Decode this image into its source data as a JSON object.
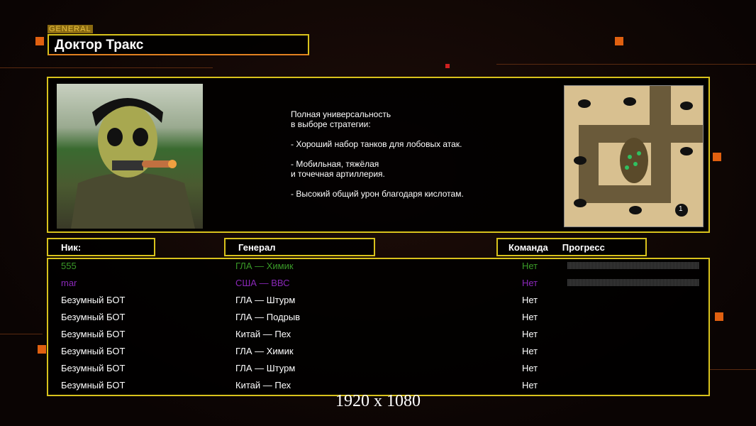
{
  "general_tag": "GENERAL",
  "general_name": "Доктор Тракс",
  "description": "Полная универсальность\nв выборе стратегии:\n\n- Хороший набор танков для лобовых атак.\n\n- Мобильная, тяжёлая\nи точечная артиллерия.\n\n- Высокий общий урон благодаря кислотам.",
  "headers": {
    "nick": "Ник:",
    "general": "Генерал",
    "team": "Команда",
    "progress": "Прогресс"
  },
  "players": [
    {
      "nick": "555",
      "general": "ГЛА — Химик",
      "team": "Нет",
      "color": "#3a9a28",
      "progress": 0
    },
    {
      "nick": "mar",
      "general": "США — ВВС",
      "team": "Нет",
      "color": "#8a28b8",
      "progress": 0
    },
    {
      "nick": "Безумный БОТ",
      "general": "ГЛА — Штурм",
      "team": "Нет",
      "color": "#ffffff"
    },
    {
      "nick": "Безумный БОТ",
      "general": "ГЛА — Подрыв",
      "team": "Нет",
      "color": "#ffffff"
    },
    {
      "nick": "Безумный БОТ",
      "general": "Китай — Пех",
      "team": "Нет",
      "color": "#ffffff"
    },
    {
      "nick": "Безумный БОТ",
      "general": "ГЛА — Химик",
      "team": "Нет",
      "color": "#ffffff"
    },
    {
      "nick": "Безумный БОТ",
      "general": "ГЛА — Штурм",
      "team": "Нет",
      "color": "#ffffff"
    },
    {
      "nick": "Безумный БОТ",
      "general": "Китай — Пех",
      "team": "Нет",
      "color": "#ffffff"
    }
  ],
  "map_start_label": "1",
  "resolution": "1920 x 1080"
}
